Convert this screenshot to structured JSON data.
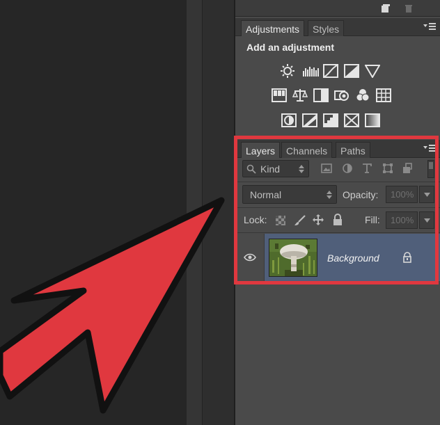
{
  "window": {
    "accent_color": "#e0383f",
    "panel_color": "#4a4a4a",
    "selected_layer_color": "#505f7a"
  },
  "adjustments_panel": {
    "tabs": [
      {
        "label": "Adjustments",
        "active": true
      },
      {
        "label": "Styles",
        "active": false
      }
    ],
    "heading": "Add an adjustment",
    "icons_row1": [
      "brightness-contrast-icon",
      "levels-icon",
      "curves-icon",
      "exposure-icon",
      "vibrance-icon"
    ],
    "icons_row2": [
      "hue-saturation-icon",
      "color-balance-icon",
      "black-white-icon",
      "photo-filter-icon",
      "channel-mixer-icon",
      "color-lookup-icon"
    ],
    "icons_row3": [
      "invert-icon",
      "posterize-icon",
      "threshold-icon",
      "selective-color-icon",
      "gradient-map-icon"
    ]
  },
  "layers_panel": {
    "tabs": [
      {
        "label": "Layers",
        "active": true
      },
      {
        "label": "Channels",
        "active": false
      },
      {
        "label": "Paths",
        "active": false
      }
    ],
    "filter": {
      "label": "Kind",
      "icons": [
        "pixel-filter-icon",
        "adjustment-filter-icon",
        "type-filter-icon",
        "shape-filter-icon",
        "smart-object-filter-icon"
      ]
    },
    "blend_mode": "Normal",
    "opacity_label": "Opacity:",
    "opacity_value": "100%",
    "lock_label": "Lock:",
    "fill_label": "Fill:",
    "fill_value": "100%",
    "layers": [
      {
        "name": "Background",
        "visible": true,
        "locked": true,
        "selected": true
      }
    ]
  }
}
